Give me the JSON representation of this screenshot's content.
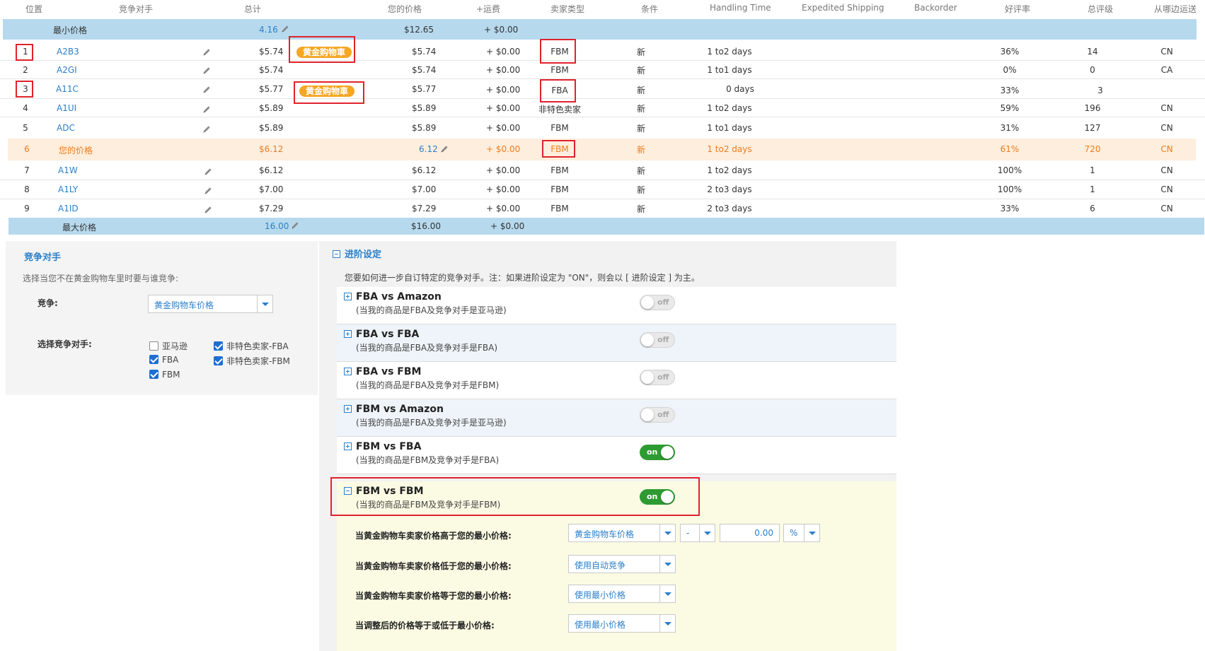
{
  "table": {
    "headers": [
      "位置",
      "竞争对手",
      "总计",
      "您的价格",
      "+运费",
      "卖家类型",
      "条件",
      "Handling Time",
      "Expedited Shipping",
      "Backorder",
      "好评率",
      "总评级",
      "从哪边运送"
    ],
    "min_row": {
      "label": "最小价格",
      "total": "4.16",
      "price": "$12.65",
      "shipping": "+ $0.00"
    },
    "max_row": {
      "label": "最大价格",
      "total": "16.00",
      "price": "$16.00",
      "shipping": "+ $0.00"
    },
    "rows": [
      {
        "pos": "1",
        "competitor": "A2B3",
        "total": "$5.74",
        "price": "$5.74",
        "shipping": "+ $0.00",
        "seller_type": "FBM",
        "condition": "新",
        "handling": "1 to2 days",
        "rating": "36%",
        "reviews": "14",
        "ships_from": "CN",
        "buybox": "黄金购物車"
      },
      {
        "pos": "2",
        "competitor": "A2GI",
        "total": "$5.74",
        "price": "$5.74",
        "shipping": "+ $0.00",
        "seller_type": "FBM",
        "condition": "新",
        "handling": "1 to1 days",
        "rating": "0%",
        "reviews": "0",
        "ships_from": "CA"
      },
      {
        "pos": "3",
        "competitor": "A11C",
        "total": "$5.77",
        "price": "$5.77",
        "shipping": "+ $0.00",
        "seller_type": "FBA",
        "condition": "新",
        "handling": "0 days",
        "rating": "33%",
        "reviews": "3",
        "ships_from": "",
        "buybox": "黄金购物車"
      },
      {
        "pos": "4",
        "competitor": "A1UI",
        "total": "$5.89",
        "price": "$5.89",
        "shipping": "+ $0.00",
        "seller_type": "非特色卖家",
        "condition": "新",
        "handling": "1 to2 days",
        "rating": "59%",
        "reviews": "196",
        "ships_from": "CN"
      },
      {
        "pos": "5",
        "competitor": "ADC",
        "total": "$5.89",
        "price": "$5.89",
        "shipping": "+ $0.00",
        "seller_type": "FBM",
        "condition": "新",
        "handling": "1 to1 days",
        "rating": "31%",
        "reviews": "127",
        "ships_from": "CN"
      },
      {
        "pos": "6",
        "competitor": "您的价格",
        "total": "$6.12",
        "price": "6.12",
        "shipping": "+ $0.00",
        "seller_type": "FBM",
        "condition": "新",
        "handling": "1 to2 days",
        "rating": "61%",
        "reviews": "720",
        "ships_from": "CN"
      },
      {
        "pos": "7",
        "competitor": "A1W",
        "total": "$6.12",
        "price": "$6.12",
        "shipping": "+ $0.00",
        "seller_type": "FBM",
        "condition": "新",
        "handling": "1 to2 days",
        "rating": "100%",
        "reviews": "1",
        "ships_from": "CN"
      },
      {
        "pos": "8",
        "competitor": "A1LY",
        "total": "$7.00",
        "price": "$7.00",
        "shipping": "+ $0.00",
        "seller_type": "FBM",
        "condition": "新",
        "handling": "2 to3 days",
        "rating": "100%",
        "reviews": "1",
        "ships_from": "CN"
      },
      {
        "pos": "9",
        "competitor": "A1ID",
        "total": "$7.29",
        "price": "$7.29",
        "shipping": "+ $0.00",
        "seller_type": "FBM",
        "condition": "新",
        "handling": "2 to3 days",
        "rating": "33%",
        "reviews": "6",
        "ships_from": "CN"
      }
    ]
  },
  "competitor_panel": {
    "title": "竞争对手",
    "description": "选择当您不在黄金购物车里时要与谁竞争:",
    "compete_label": "竞争:",
    "compete_value": "黄金购物车价格",
    "select_label": "选择竞争对手:",
    "checkboxes": {
      "amazon": {
        "label": "亚马逊",
        "checked": false
      },
      "nonfeatured_fba": {
        "label": "非特色卖家-FBA",
        "checked": true
      },
      "fba": {
        "label": "FBA",
        "checked": true
      },
      "nonfeatured_fbm": {
        "label": "非特色卖家-FBM",
        "checked": true
      },
      "fbm": {
        "label": "FBM",
        "checked": true
      }
    }
  },
  "advanced": {
    "title": "进阶设定",
    "description": "您要如何进一步自订特定的竞争对手。注：如果进阶设定为 \"ON\"，则会以 [ 进阶设定 ] 为主。",
    "rules": [
      {
        "title": "FBA vs Amazon",
        "subtitle": "(当我的商品是FBA及竞争对手是亚马逊)",
        "state": "off"
      },
      {
        "title": "FBA vs FBA",
        "subtitle": "(当我的商品是FBA及竞争对手是FBA)",
        "state": "off"
      },
      {
        "title": "FBA vs FBM",
        "subtitle": "(当我的商品是FBA及竞争对手是FBM)",
        "state": "off"
      },
      {
        "title": "FBM vs Amazon",
        "subtitle": "(当我的商品是FBA及竞争对手是亚马逊)",
        "state": "off"
      },
      {
        "title": "FBM vs FBA",
        "subtitle": "(当我的商品是FBM及竞争对手是FBA)",
        "state": "on"
      },
      {
        "title": "FBM vs FBM",
        "subtitle": "(当我的商品是FBM及竞争对手是FBM)",
        "state": "on"
      }
    ],
    "expanded": {
      "higher_label": "当黄金购物车卖家价格高于您的最小价格:",
      "higher_select": "黄金购物车价格",
      "higher_op": "-",
      "higher_amount": "0.00",
      "higher_unit": "%",
      "lower_label": "当黄金购物车卖家价格低于您的最小价格:",
      "lower_select": "使用自动竞争",
      "equal_label": "当黄金购物车卖家价格等于您的最小价格:",
      "equal_select": "使用最小价格",
      "adjusted_label": "当调整后的价格等于或低于最小价格:",
      "adjusted_select": "使用最小价格"
    }
  },
  "colors": {
    "accent": "#2a7fc9",
    "band": "#b6d9ee",
    "mine": "#f07c1c",
    "badge": "#f5a623",
    "highlight": "#e0232d",
    "toggle_on": "#2e9b32"
  }
}
